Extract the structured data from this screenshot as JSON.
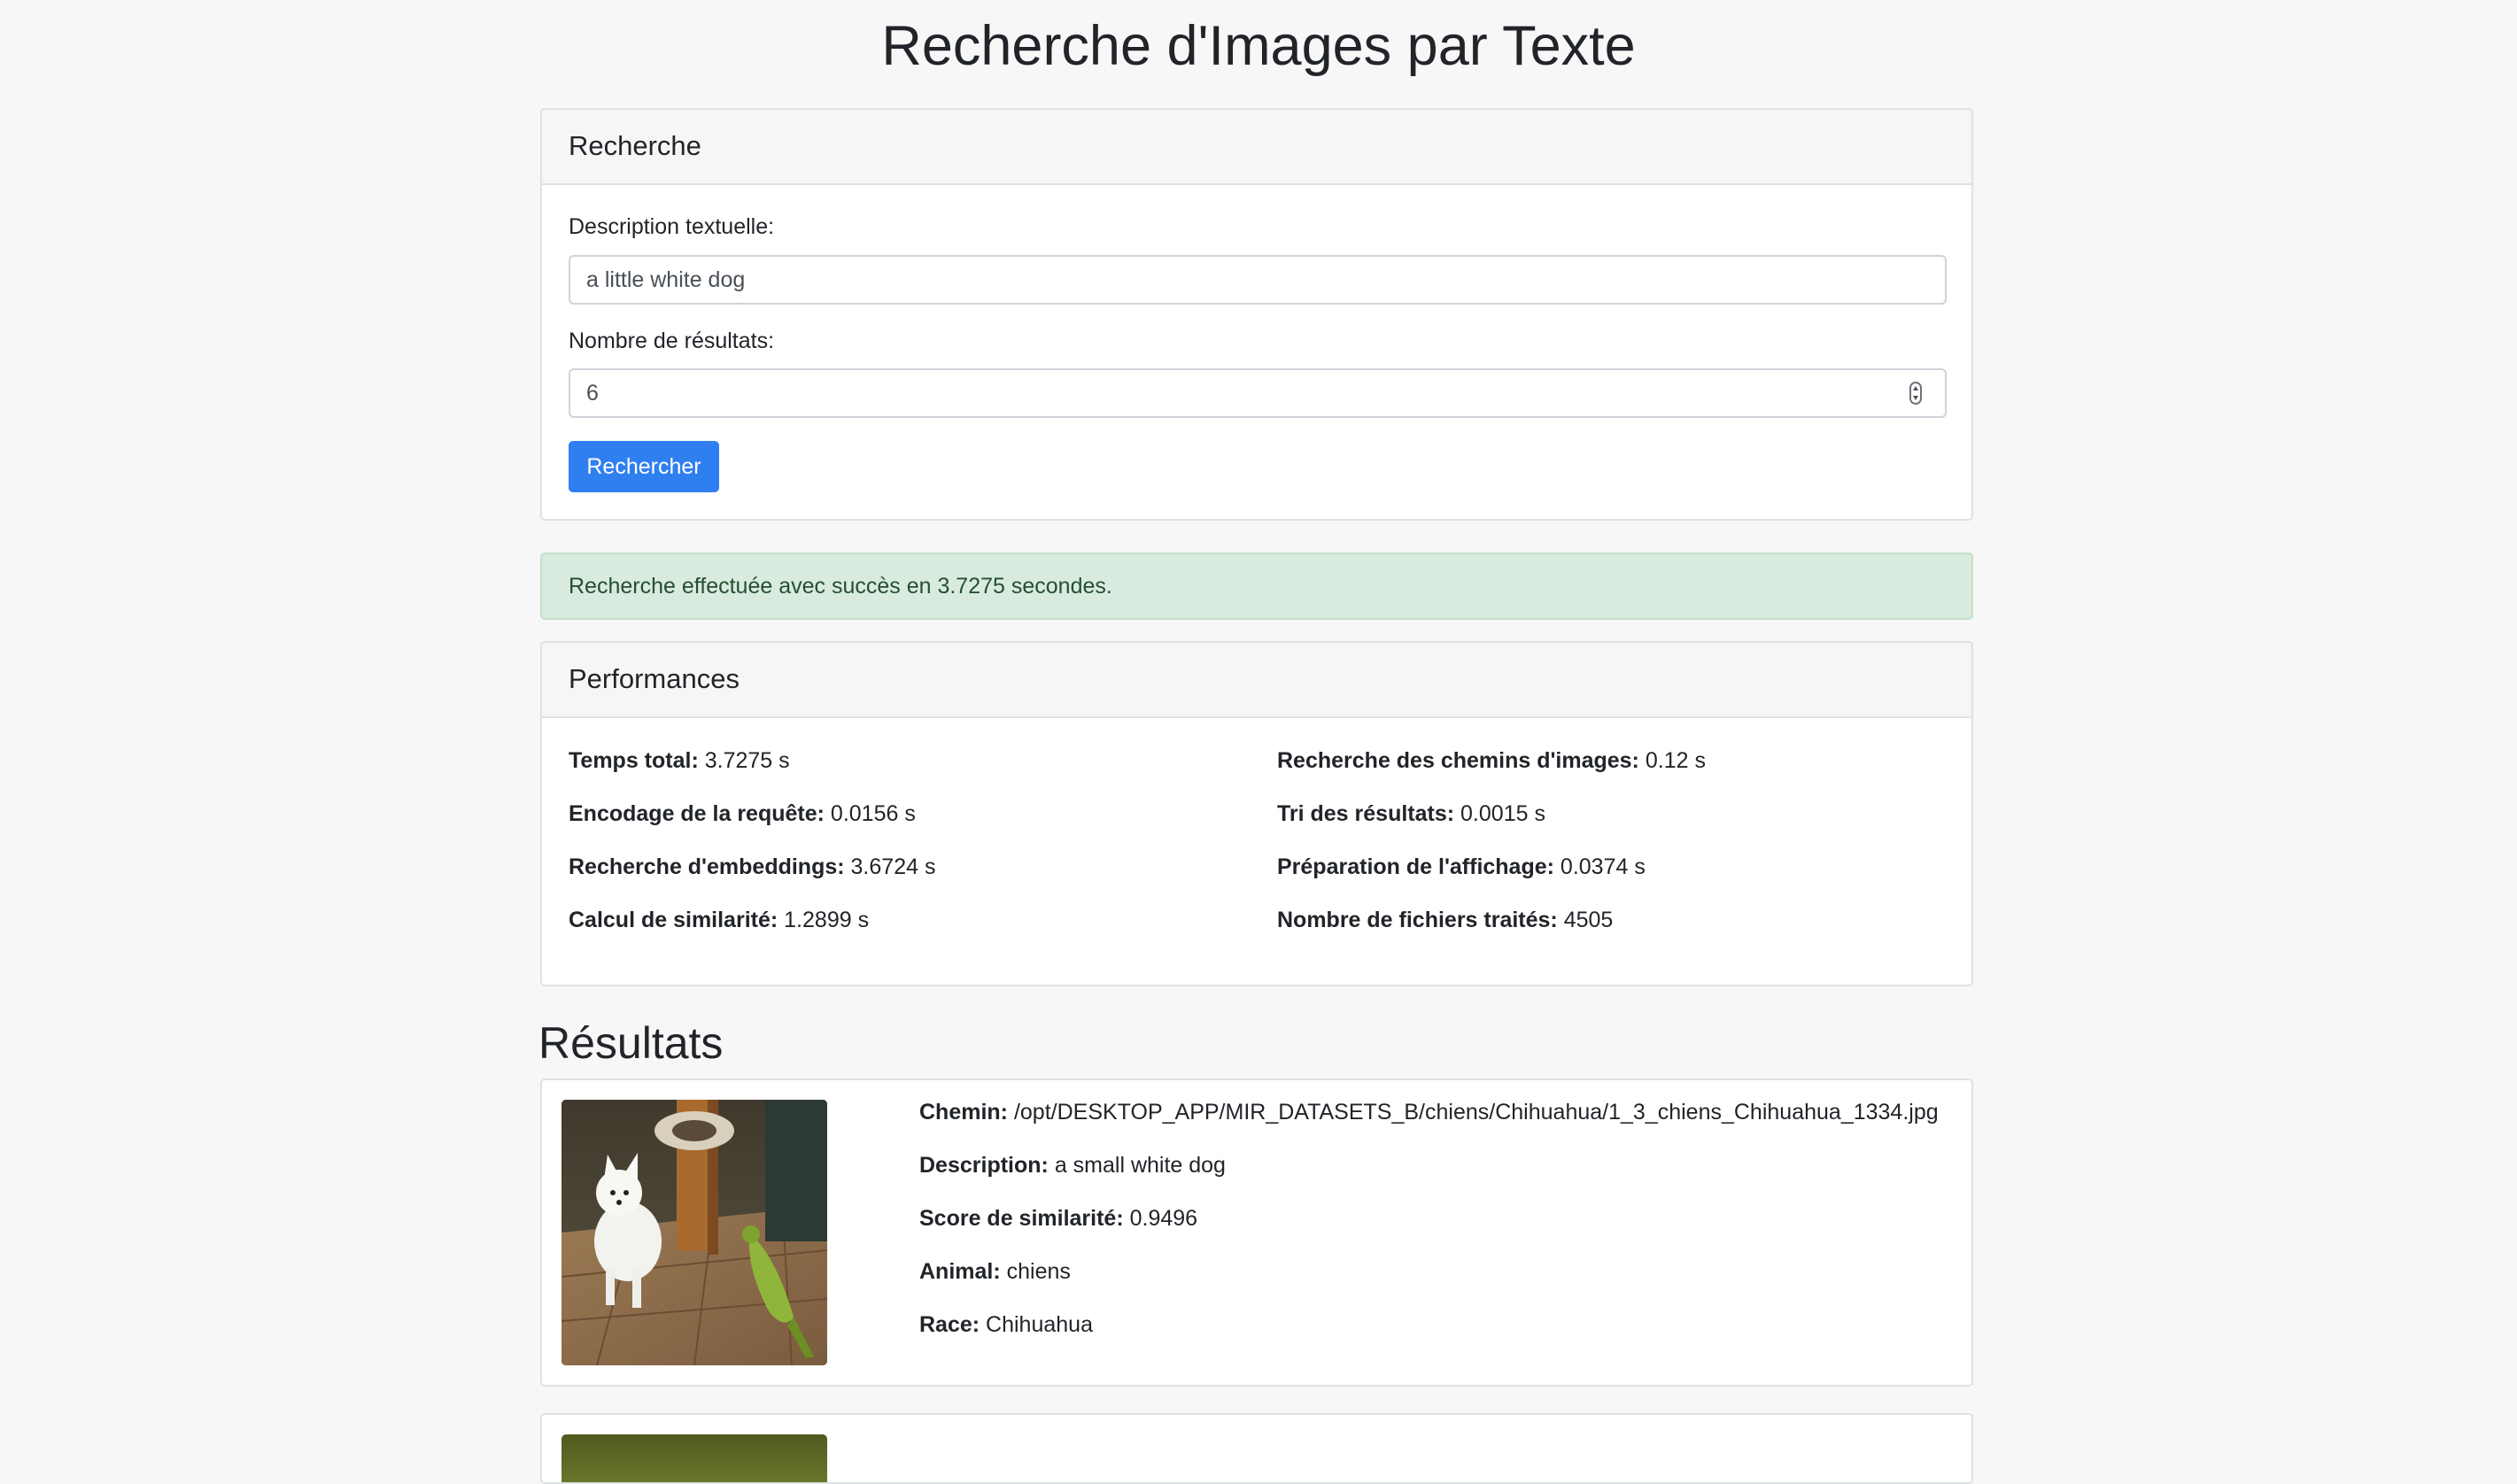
{
  "page": {
    "title": "Recherche d'Images par Texte"
  },
  "search": {
    "header": "Recherche",
    "description_label": "Description textuelle:",
    "description_value": "a little white dog",
    "count_label": "Nombre de résultats:",
    "count_value": "6",
    "submit_label": "Rechercher"
  },
  "alert": {
    "message": "Recherche effectuée avec succès en 3.7275 secondes."
  },
  "performance": {
    "header": "Performances",
    "left": [
      {
        "label": "Temps total:",
        "value": "3.7275 s"
      },
      {
        "label": "Encodage de la requête:",
        "value": "0.0156 s"
      },
      {
        "label": "Recherche d'embeddings:",
        "value": "3.6724 s"
      },
      {
        "label": "Calcul de similarité:",
        "value": "1.2899 s"
      }
    ],
    "right": [
      {
        "label": "Recherche des chemins d'images:",
        "value": "0.12 s"
      },
      {
        "label": "Tri des résultats:",
        "value": "0.0015 s"
      },
      {
        "label": "Préparation de l'affichage:",
        "value": "0.0374 s"
      },
      {
        "label": "Nombre de fichiers traités:",
        "value": "4505"
      }
    ]
  },
  "results": {
    "title": "Résultats",
    "items": [
      {
        "path_label": "Chemin:",
        "path": "/opt/DESKTOP_APP/MIR_DATASETS_B/chiens/Chihuahua/1_3_chiens_Chihuahua_1334.jpg",
        "description_label": "Description:",
        "description": "a small white dog",
        "score_label": "Score de similarité:",
        "score": "0.9496",
        "animal_label": "Animal:",
        "animal": "chiens",
        "breed_label": "Race:",
        "breed": "Chihuahua"
      }
    ]
  },
  "colors": {
    "primary": "#2f7ff0",
    "success_bg": "#d9eadf",
    "success_text": "#24502f",
    "page_bg": "#f7f7f8"
  }
}
